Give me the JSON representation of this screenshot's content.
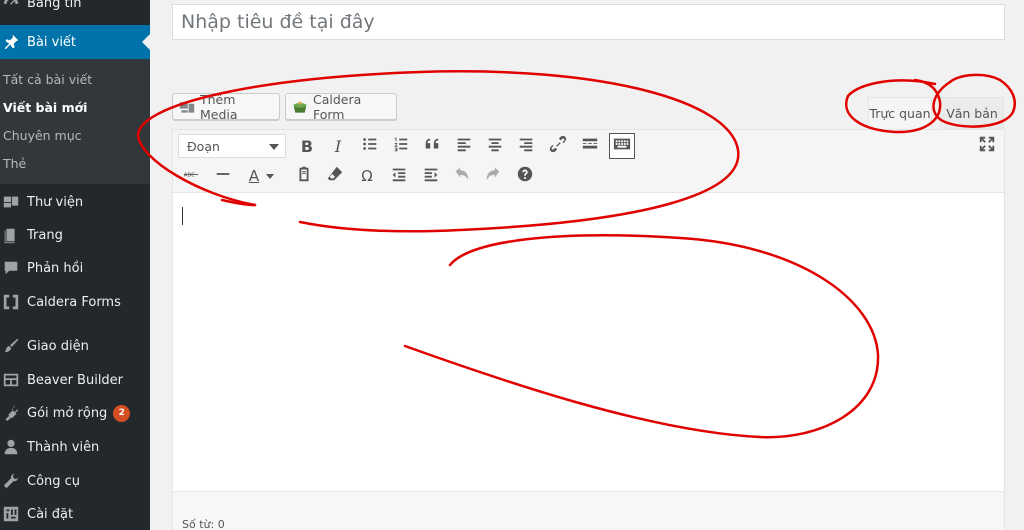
{
  "sidebar": {
    "dashboard_label": "Bảng tin",
    "posts_label": "Bài viết",
    "submenu": [
      "Tất cả bài viết",
      "Viết bài mới",
      "Chuyên mục",
      "Thẻ"
    ],
    "media_label": "Thư viện",
    "pages_label": "Trang",
    "comments_label": "Phản hồi",
    "caldera_label": "Caldera Forms",
    "appearance_label": "Giao diện",
    "beaver_label": "Beaver Builder",
    "plugins_label": "Gói mở rộng",
    "plugins_badge": "2",
    "users_label": "Thành viên",
    "tools_label": "Công cụ",
    "settings_label": "Cài đặt"
  },
  "title": {
    "placeholder": "Nhập tiêu đề tại đây"
  },
  "media_buttons": {
    "add_media": "Thêm Media",
    "caldera_form": "Caldera Form"
  },
  "tabs": {
    "visual": "Trực quan",
    "text": "Văn bản"
  },
  "toolbar": {
    "format_value": "Đoạn",
    "bold": "B",
    "italic": "I",
    "text_color": "A",
    "special_char": "Ω"
  },
  "status": {
    "word_count": "Số từ: 0"
  },
  "colors": {
    "sidebar_bg": "#23282d",
    "active": "#0073aa",
    "annotation": "#e00000",
    "badge": "#d54e21"
  }
}
